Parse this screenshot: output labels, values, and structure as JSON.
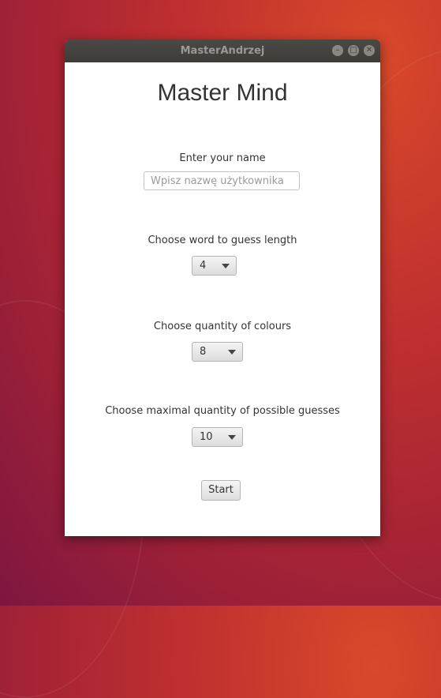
{
  "window": {
    "title": "MasterAndrzej"
  },
  "app": {
    "title": "Master Mind",
    "name_label": "Enter your name",
    "name_placeholder": "Wpisz nazwę użytkownika",
    "name_value": "",
    "length_label": "Choose word to guess length",
    "length_value": "4",
    "colours_label": "Choose quantity of colours",
    "colours_value": "8",
    "guesses_label": "Choose maximal quantity of possible guesses",
    "guesses_value": "10",
    "start_label": "Start"
  },
  "icons": {
    "minimize": "minimize-icon",
    "maximize": "maximize-icon",
    "close": "close-icon",
    "dropdown": "triangle-down-icon"
  }
}
